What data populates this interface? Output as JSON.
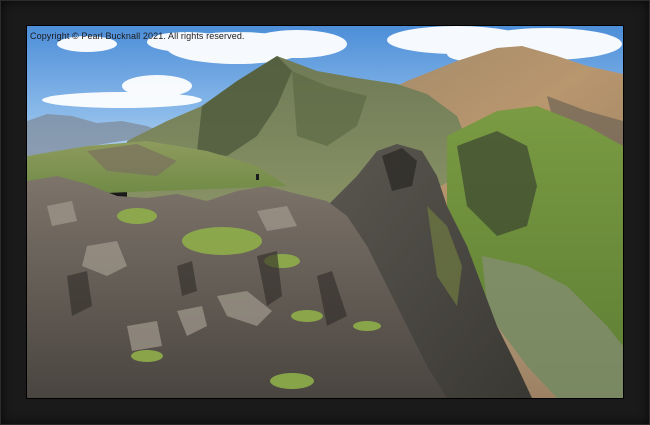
{
  "photo": {
    "copyright": "Copyright © Pearl Bucknall 2021. All rights reserved."
  }
}
